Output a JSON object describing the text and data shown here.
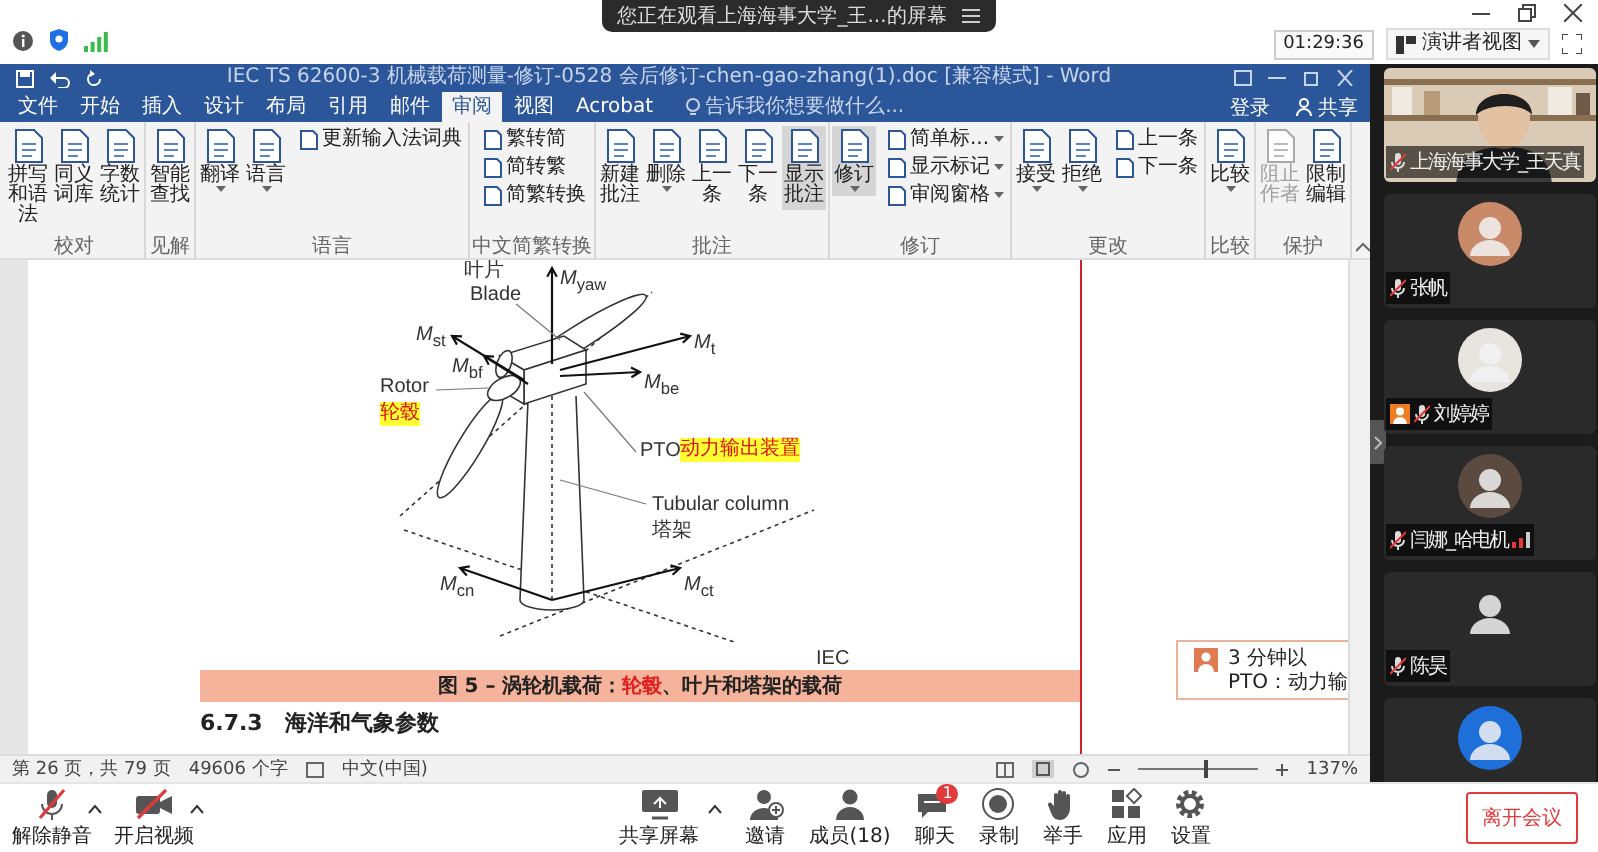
{
  "meeting": {
    "share_notice": "您正在观看上海海事大学_王...的屏幕",
    "timer": "01:29:36",
    "view_button": "演讲者视图"
  },
  "word": {
    "title": "IEC TS 62600-3 机械载荷测量-修订-0528 会后修订-chen-gao-zhang(1).doc [兼容模式] - Word",
    "tabs": [
      {
        "label": "文件",
        "selected": false
      },
      {
        "label": "开始",
        "selected": false
      },
      {
        "label": "插入",
        "selected": false
      },
      {
        "label": "设计",
        "selected": false
      },
      {
        "label": "布局",
        "selected": false
      },
      {
        "label": "引用",
        "selected": false
      },
      {
        "label": "邮件",
        "selected": false
      },
      {
        "label": "审阅",
        "selected": true
      },
      {
        "label": "视图",
        "selected": false
      },
      {
        "label": "Acrobat",
        "selected": false
      }
    ],
    "search": {
      "placeholder": "告诉我你想要做什么..."
    },
    "sign_in": "登录",
    "share": "共享",
    "ribbon": [
      {
        "label": "校对",
        "commands": [
          {
            "label": "拼写和语法",
            "kind": "large",
            "on": false,
            "disabled": false,
            "dropdown": false
          },
          {
            "label": "同义词库",
            "kind": "large",
            "on": false,
            "disabled": false,
            "dropdown": false
          },
          {
            "label": "字数统计",
            "kind": "large",
            "on": false,
            "disabled": false,
            "dropdown": false
          }
        ]
      },
      {
        "label": "见解",
        "commands": [
          {
            "label": "智能查找",
            "kind": "large",
            "on": false,
            "disabled": false,
            "dropdown": false
          }
        ]
      },
      {
        "label": "语言",
        "commands": [
          {
            "label": "翻译",
            "kind": "large",
            "on": false,
            "disabled": false,
            "dropdown": true
          },
          {
            "label": "语言",
            "kind": "large",
            "on": false,
            "disabled": false,
            "dropdown": true
          },
          {
            "label": "更新输入法词典",
            "kind": "small",
            "on": false,
            "disabled": false,
            "dropdown": false
          }
        ]
      },
      {
        "label": "中文简繁转换",
        "commands": [
          {
            "label": "繁转简",
            "kind": "small",
            "on": false,
            "disabled": false,
            "dropdown": false
          },
          {
            "label": "简转繁",
            "kind": "small",
            "on": false,
            "disabled": false,
            "dropdown": false
          },
          {
            "label": "简繁转换",
            "kind": "small",
            "on": false,
            "disabled": false,
            "dropdown": false
          }
        ]
      },
      {
        "label": "批注",
        "commands": [
          {
            "label": "新建批注",
            "kind": "large",
            "on": false,
            "disabled": false,
            "dropdown": false
          },
          {
            "label": "删除",
            "kind": "large",
            "on": false,
            "disabled": false,
            "dropdown": true
          },
          {
            "label": "上一条",
            "kind": "large",
            "on": false,
            "disabled": false,
            "dropdown": false
          },
          {
            "label": "下一条",
            "kind": "large",
            "on": false,
            "disabled": false,
            "dropdown": false
          },
          {
            "label": "显示批注",
            "kind": "large",
            "on": true,
            "disabled": false,
            "dropdown": false
          }
        ]
      },
      {
        "label": "修订",
        "commands": [
          {
            "label": "修订",
            "kind": "large",
            "on": true,
            "disabled": false,
            "dropdown": true
          },
          {
            "label": "简单标...",
            "kind": "small",
            "on": false,
            "disabled": false,
            "dropdown": true
          },
          {
            "label": "显示标记",
            "kind": "small",
            "on": false,
            "disabled": false,
            "dropdown": true
          },
          {
            "label": "审阅窗格",
            "kind": "small",
            "on": false,
            "disabled": false,
            "dropdown": true
          }
        ]
      },
      {
        "label": "更改",
        "commands": [
          {
            "label": "接受",
            "kind": "large",
            "on": false,
            "disabled": false,
            "dropdown": true
          },
          {
            "label": "拒绝",
            "kind": "large",
            "on": false,
            "disabled": false,
            "dropdown": true
          },
          {
            "label": "上一条",
            "kind": "small",
            "on": false,
            "disabled": false,
            "dropdown": false
          },
          {
            "label": "下一条",
            "kind": "small",
            "on": false,
            "disabled": false,
            "dropdown": false
          }
        ]
      },
      {
        "label": "比较",
        "commands": [
          {
            "label": "比较",
            "kind": "large",
            "on": false,
            "disabled": false,
            "dropdown": true
          }
        ]
      },
      {
        "label": "保护",
        "commands": [
          {
            "label": "阻止作者",
            "kind": "large",
            "on": false,
            "disabled": true,
            "dropdown": false
          },
          {
            "label": "限制编辑",
            "kind": "large",
            "on": false,
            "disabled": false,
            "dropdown": false
          }
        ]
      }
    ],
    "document": {
      "diagram_labels": [
        {
          "text": "叶片",
          "highlight": false
        },
        {
          "text": "Blade",
          "highlight": false
        },
        {
          "text": "*M*$_{yaw}$",
          "highlight": false
        },
        {
          "text": "*M*$_{st}$",
          "highlight": false
        },
        {
          "text": "*M*$_{bf}$",
          "highlight": false
        },
        {
          "text": "*M*$_{t}$",
          "highlight": false
        },
        {
          "text": "*M*$_{be}$",
          "highlight": false
        },
        {
          "text": "Rotor",
          "highlight": false
        },
        {
          "text": "轮毂",
          "highlight": true
        },
        {
          "text": "PTO",
          "highlight": false
        },
        {
          "text": "动力输出装置",
          "highlight": true
        },
        {
          "text": "Tubular column",
          "highlight": false
        },
        {
          "text": "塔架",
          "highlight": false
        },
        {
          "text": "*M*$_{cn}$",
          "highlight": false
        },
        {
          "text": "*M*$_{ct}$",
          "highlight": false
        },
        {
          "text": "IEC",
          "highlight": false
        }
      ],
      "caption": [
        {
          "text": "图 5 – 涡轮机载荷：",
          "revised": false
        },
        {
          "text": "轮毂",
          "revised": true
        },
        {
          "text": "、叶片和塔架的载荷",
          "revised": false
        }
      ],
      "heading": "6.7.3　海洋和气象参数"
    },
    "comment": {
      "time": "3 分钟以",
      "text": "PTO：动力输"
    },
    "status_bar": {
      "page": "第 26 页，共 79 页",
      "words": "49606 个字",
      "language": "中文(中国)",
      "zoom": {
        "level": 0.55,
        "reading": "137%"
      }
    }
  },
  "participants": [
    {
      "name": "上海海事大学_王天真",
      "kind": "video",
      "host_badge": false,
      "weak_network": false
    },
    {
      "name": "张帆",
      "kind": "avatar",
      "color": "#c98a6a",
      "host_badge": false,
      "weak_network": false
    },
    {
      "name": "刘婷婷",
      "kind": "avatar",
      "color": "#e8e4e0",
      "host_badge": true,
      "weak_network": false
    },
    {
      "name": "闫娜_哈电机",
      "kind": "avatar",
      "color": "#5a4a40",
      "host_badge": false,
      "weak_network": true
    },
    {
      "name": "陈昊",
      "kind": "avatar",
      "color": "#2a2a2a",
      "host_badge": false,
      "weak_network": false
    },
    {
      "kind": "avatar",
      "color": "#1e6fd9"
    }
  ],
  "toolbar": {
    "left": [
      {
        "label": "解除静音",
        "kind": "mic",
        "crossed": true,
        "menu": true
      },
      {
        "label": "开启视频",
        "kind": "camera",
        "crossed": true,
        "menu": true
      }
    ],
    "center": [
      {
        "label": "共享屏幕",
        "kind": "share",
        "menu": true
      },
      {
        "label": "邀请",
        "kind": "invite",
        "menu": false
      },
      {
        "label": "成员(18)",
        "kind": "members",
        "menu": false
      },
      {
        "label": "聊天",
        "kind": "chat",
        "menu": false,
        "badge": "1"
      },
      {
        "label": "录制",
        "kind": "record",
        "menu": false
      },
      {
        "label": "举手",
        "kind": "hand",
        "menu": false
      },
      {
        "label": "应用",
        "kind": "apps",
        "menu": false
      },
      {
        "label": "设置",
        "kind": "settings",
        "menu": false
      }
    ],
    "leave": "离开会议"
  }
}
